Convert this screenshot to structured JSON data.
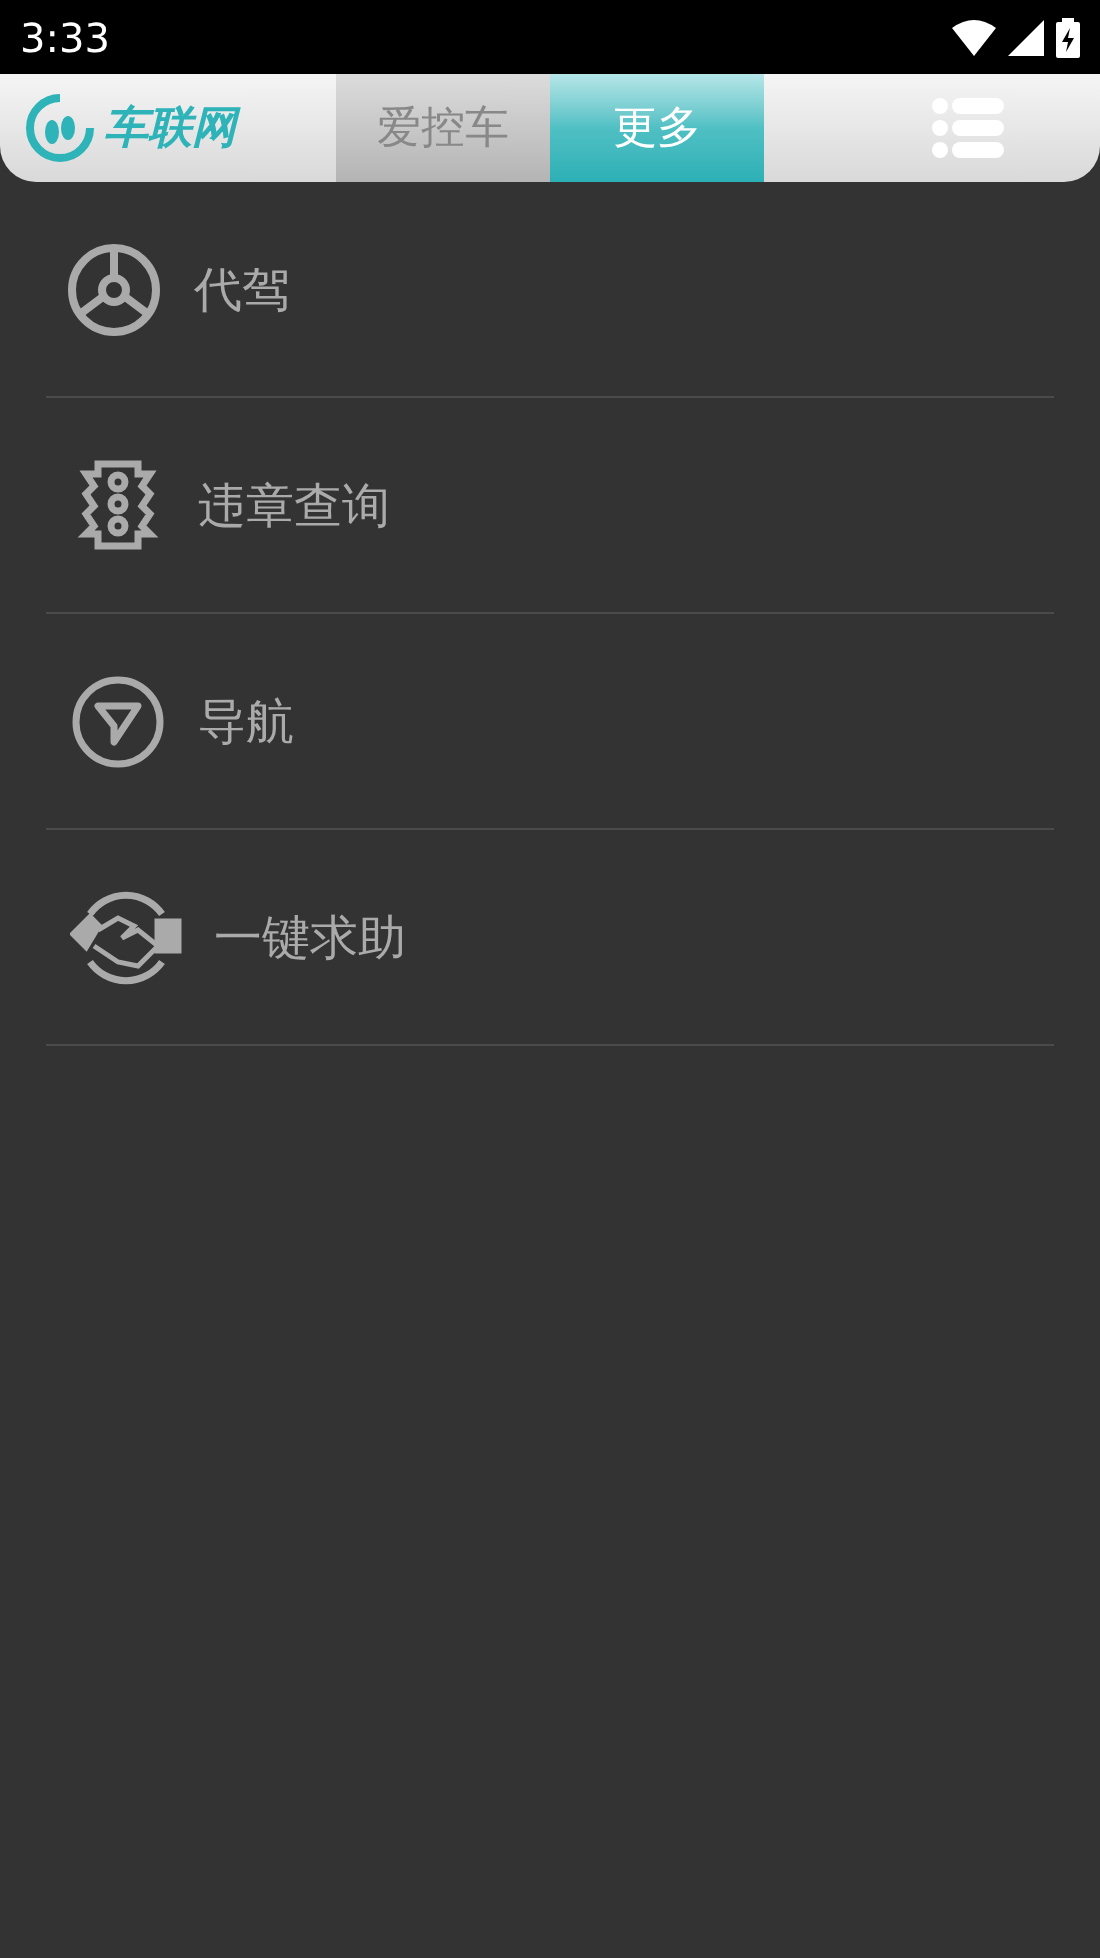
{
  "status_bar": {
    "time": "3:33"
  },
  "header": {
    "logo_text": "车联网",
    "tabs": [
      {
        "label": "爱控车",
        "selected": false
      },
      {
        "label": "更多",
        "selected": true
      }
    ]
  },
  "menu": [
    {
      "kind": "wheel",
      "label": "代驾"
    },
    {
      "kind": "traffic",
      "label": "违章查询"
    },
    {
      "kind": "navigation",
      "label": "导航"
    },
    {
      "kind": "handshake",
      "label": "一键求助"
    }
  ]
}
